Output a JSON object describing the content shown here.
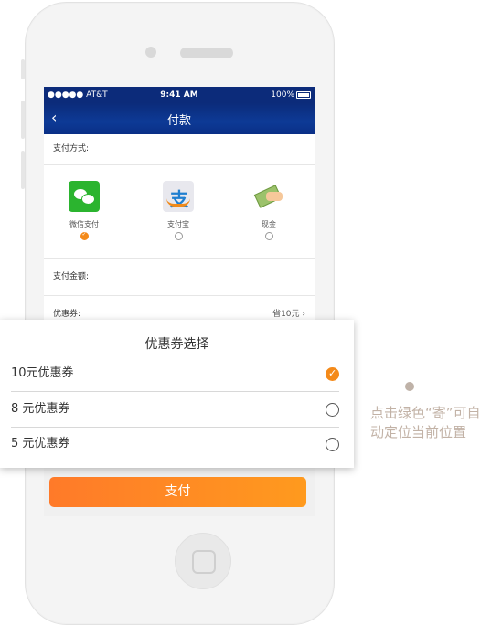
{
  "status": {
    "carrier": "●●●●● AT&T",
    "time": "9:41 AM",
    "battery": "100%"
  },
  "nav": {
    "title": "付款",
    "back_icon": "chevron-left-icon"
  },
  "payment": {
    "method_label": "支付方式:",
    "methods": [
      {
        "label": "微信支付",
        "selected": true,
        "icon": "wechat-icon"
      },
      {
        "label": "支付宝",
        "selected": false,
        "icon": "alipay-icon"
      },
      {
        "label": "现金",
        "selected": false,
        "icon": "cash-icon"
      }
    ],
    "amount_label": "支付金额:",
    "coupon_label": "优惠券:",
    "coupon_value": "省10元",
    "pay_button": "支付"
  },
  "popup": {
    "title": "优惠券选择",
    "options": [
      {
        "label": "10元优惠券",
        "selected": true
      },
      {
        "label": "8 元优惠券",
        "selected": false
      },
      {
        "label": "5 元优惠券",
        "selected": false
      }
    ]
  },
  "callout": {
    "text": "点击绿色“寄”可自动定位当前位置"
  },
  "colors": {
    "accent": "#f48a1a",
    "nav": "#0c2b7a",
    "wechat": "#2bb42f"
  }
}
